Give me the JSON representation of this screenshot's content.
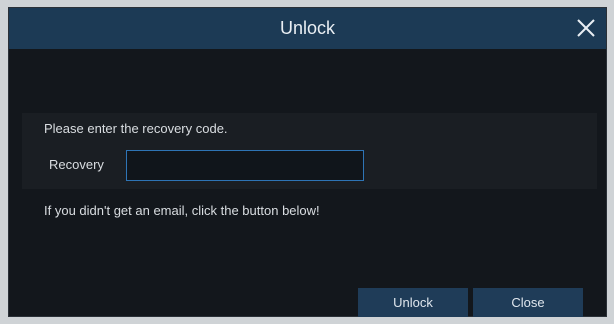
{
  "dialog": {
    "title": "Unlock",
    "close_icon": "close-icon"
  },
  "form": {
    "prompt": "Please enter the recovery code.",
    "recovery_label": "Recovery",
    "recovery_value": "",
    "hint": "If you didn't get an email, click the button below!"
  },
  "buttons": {
    "unlock_label": "Unlock",
    "close_label": "Close"
  },
  "colors": {
    "titlebar": "#1c3a55",
    "background": "#13171c",
    "input_border": "#2e74b5",
    "button": "#1f3c58"
  }
}
